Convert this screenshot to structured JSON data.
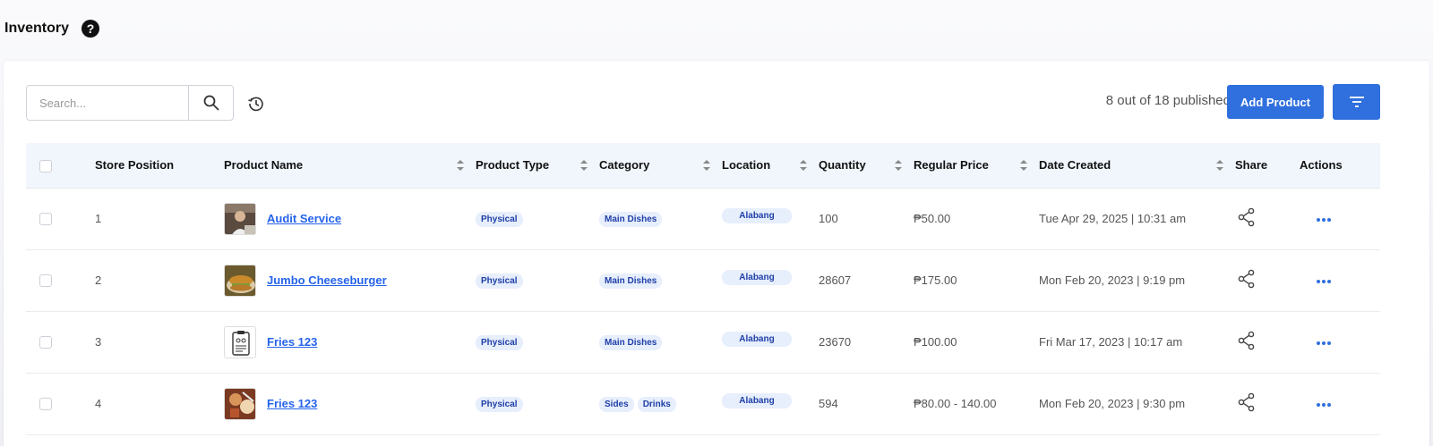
{
  "header": {
    "title": "Inventory",
    "help_glyph": "?"
  },
  "toolbar": {
    "search_placeholder": "Search...",
    "published_text": "8 out of 18 published",
    "add_label": "Add Product"
  },
  "columns": {
    "store_position": "Store Position",
    "product_name": "Product Name",
    "product_type": "Product Type",
    "category": "Category",
    "location": "Location",
    "quantity": "Quantity",
    "regular_price": "Regular Price",
    "date_created": "Date Created",
    "share": "Share",
    "actions": "Actions"
  },
  "rows": [
    {
      "position": "1",
      "name": "Audit Service",
      "type": "Physical",
      "categories": [
        "Main Dishes"
      ],
      "location": "Alabang",
      "quantity": "100",
      "price": "₱50.00",
      "date": "Tue Apr 29, 2025 | 10:31 am",
      "thumb": "photo-person"
    },
    {
      "position": "2",
      "name": "Jumbo Cheeseburger",
      "type": "Physical",
      "categories": [
        "Main Dishes"
      ],
      "location": "Alabang",
      "quantity": "28607",
      "price": "₱175.00",
      "date": "Mon Feb 20, 2023 | 9:19 pm",
      "thumb": "photo-burger"
    },
    {
      "position": "3",
      "name": "Fries 123",
      "type": "Physical",
      "categories": [
        "Main Dishes"
      ],
      "location": "Alabang",
      "quantity": "23670",
      "price": "₱100.00",
      "date": "Fri Mar 17, 2023 | 10:17 am",
      "thumb": "clipboard-icon"
    },
    {
      "position": "4",
      "name": "Fries 123",
      "type": "Physical",
      "categories": [
        "Sides",
        "Drinks"
      ],
      "location": "Alabang",
      "quantity": "594",
      "price": "₱80.00 - 140.00",
      "date": "Mon Feb 20, 2023 | 9:30 pm",
      "thumb": "photo-food"
    }
  ],
  "icons": {
    "help": "question-circle-icon",
    "search": "search-icon",
    "history": "history-icon",
    "filter": "filter-icon",
    "sort": "sort-icon",
    "share": "share-icon",
    "actions": "more-horizontal-icon"
  },
  "colors": {
    "accent": "#2f6fde",
    "link": "#2563eb",
    "tag_bg": "#e7eefc",
    "tag_text": "#1e3fa8",
    "header_bg": "#f1f6fd"
  }
}
